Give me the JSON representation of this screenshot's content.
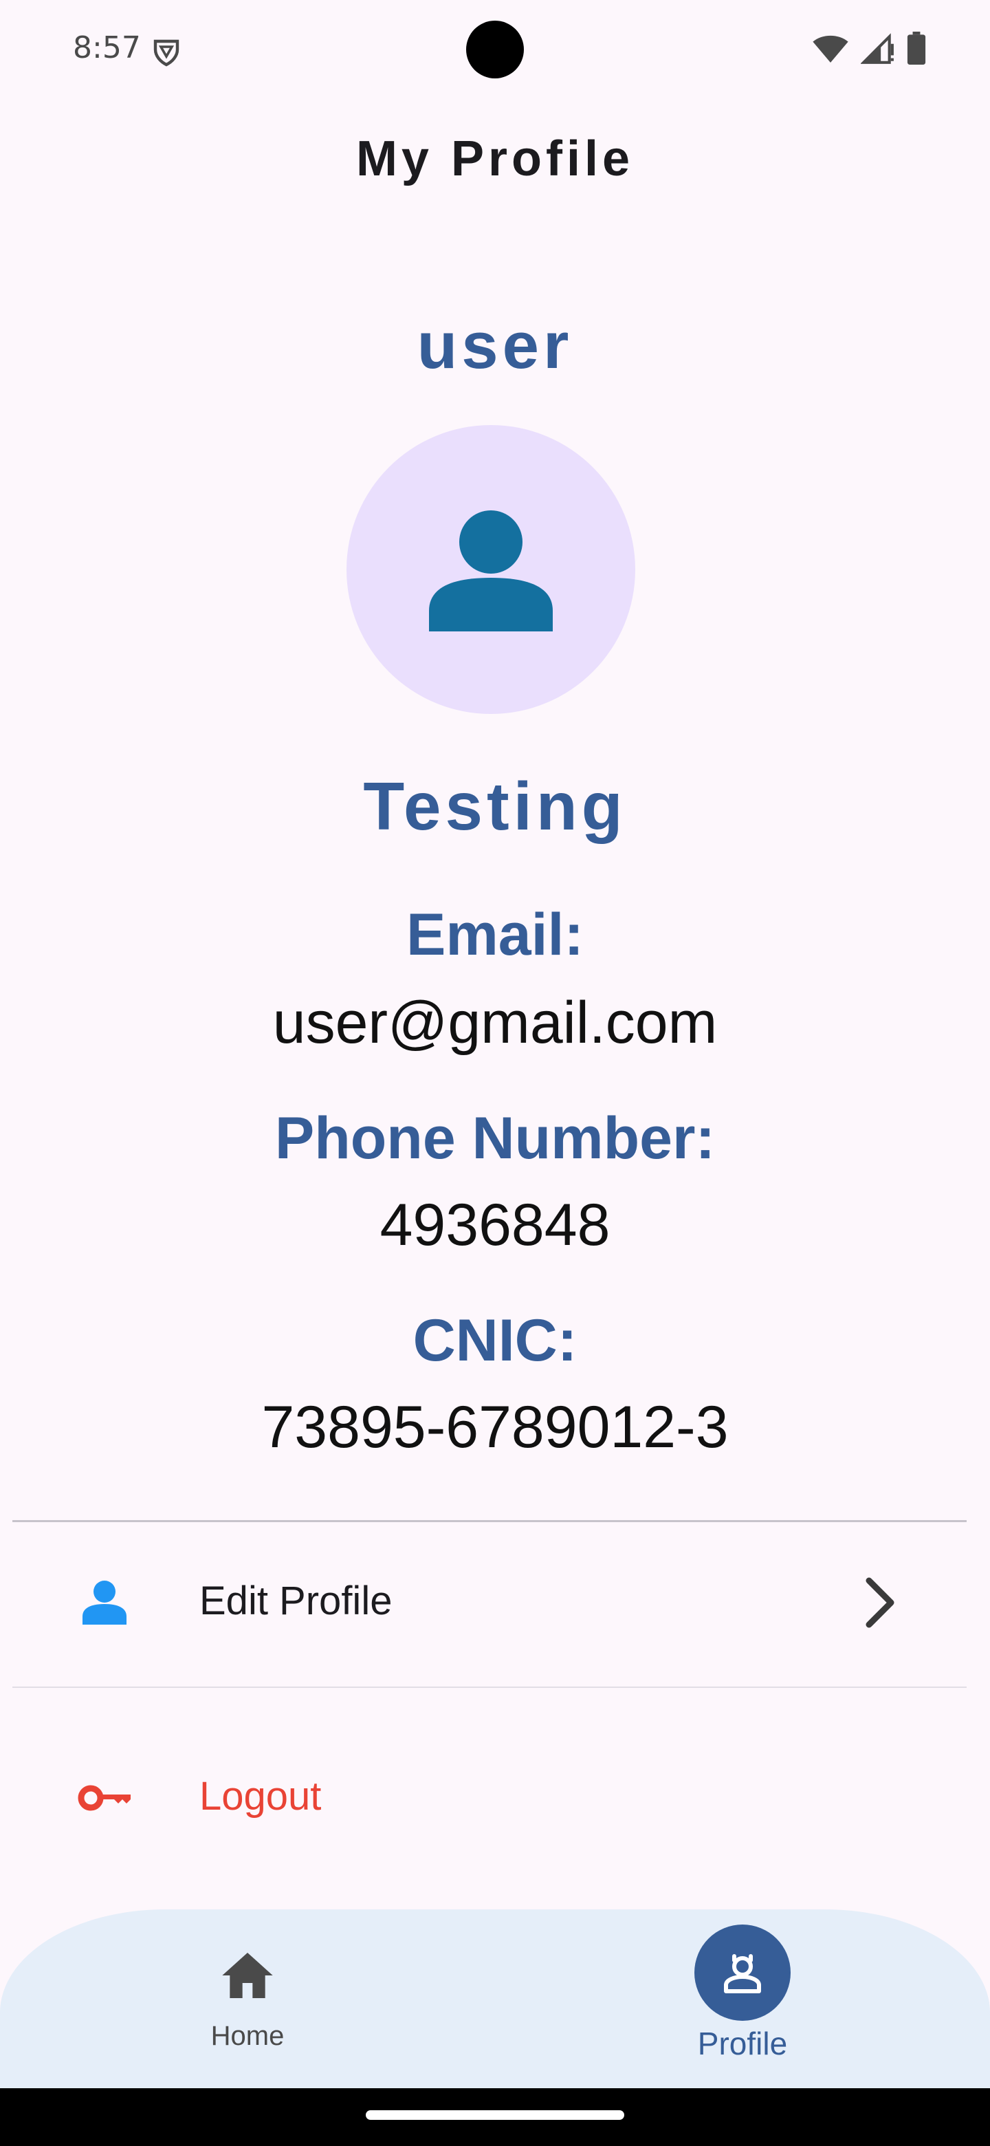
{
  "status_bar": {
    "time": "8:57"
  },
  "header": {
    "title": "My Profile"
  },
  "profile": {
    "username": "user",
    "full_name": "Testing",
    "email_label": "Email:",
    "email": "user@gmail.com",
    "phone_label": "Phone Number:",
    "phone": "4936848",
    "cnic_label": "CNIC:",
    "cnic": "73895-6789012-3"
  },
  "menu": {
    "edit_profile_label": "Edit Profile",
    "logout_label": "Logout"
  },
  "bottom_nav": {
    "items": [
      {
        "label": "Home",
        "icon": "home-icon",
        "selected": false
      },
      {
        "label": "Profile",
        "icon": "profile-badge-icon",
        "selected": true
      }
    ]
  },
  "colors": {
    "background": "#fdf7fc",
    "accent": "#365d97",
    "avatar_bg": "#eadffd",
    "avatar_icon": "#14709f",
    "edit_icon": "#2196f3",
    "logout": "#e94335",
    "nav_bg": "#e5eef9"
  }
}
